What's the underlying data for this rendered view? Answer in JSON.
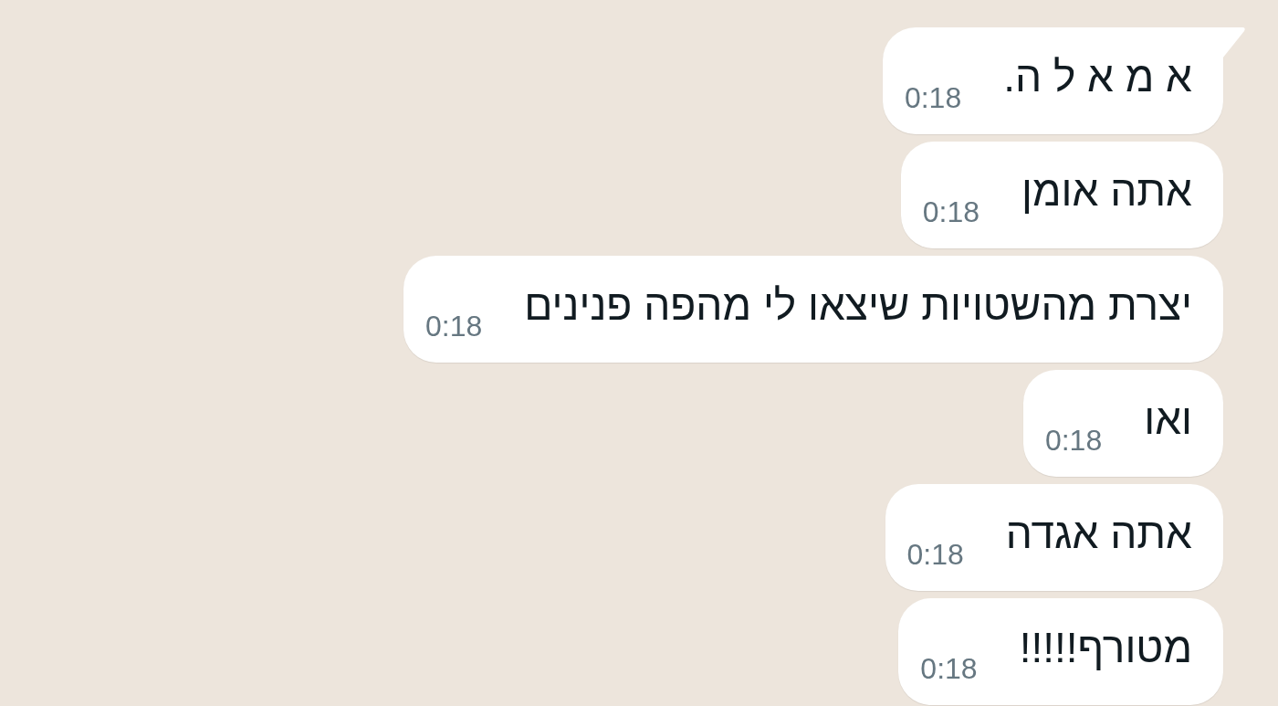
{
  "messages": [
    {
      "text": "א מ א ל ה.",
      "time": "0:18",
      "tail": true
    },
    {
      "text": "אתה אומן",
      "time": "0:18",
      "tail": false
    },
    {
      "text": "יצרת מהשטויות שיצאו לי מהפה פנינים",
      "time": "0:18",
      "tail": false
    },
    {
      "text": "ואו",
      "time": "0:18",
      "tail": false
    },
    {
      "text": "אתה אגדה",
      "time": "0:18",
      "tail": false
    },
    {
      "text": "מטורף!!!!!",
      "time": "0:18",
      "tail": false
    }
  ]
}
